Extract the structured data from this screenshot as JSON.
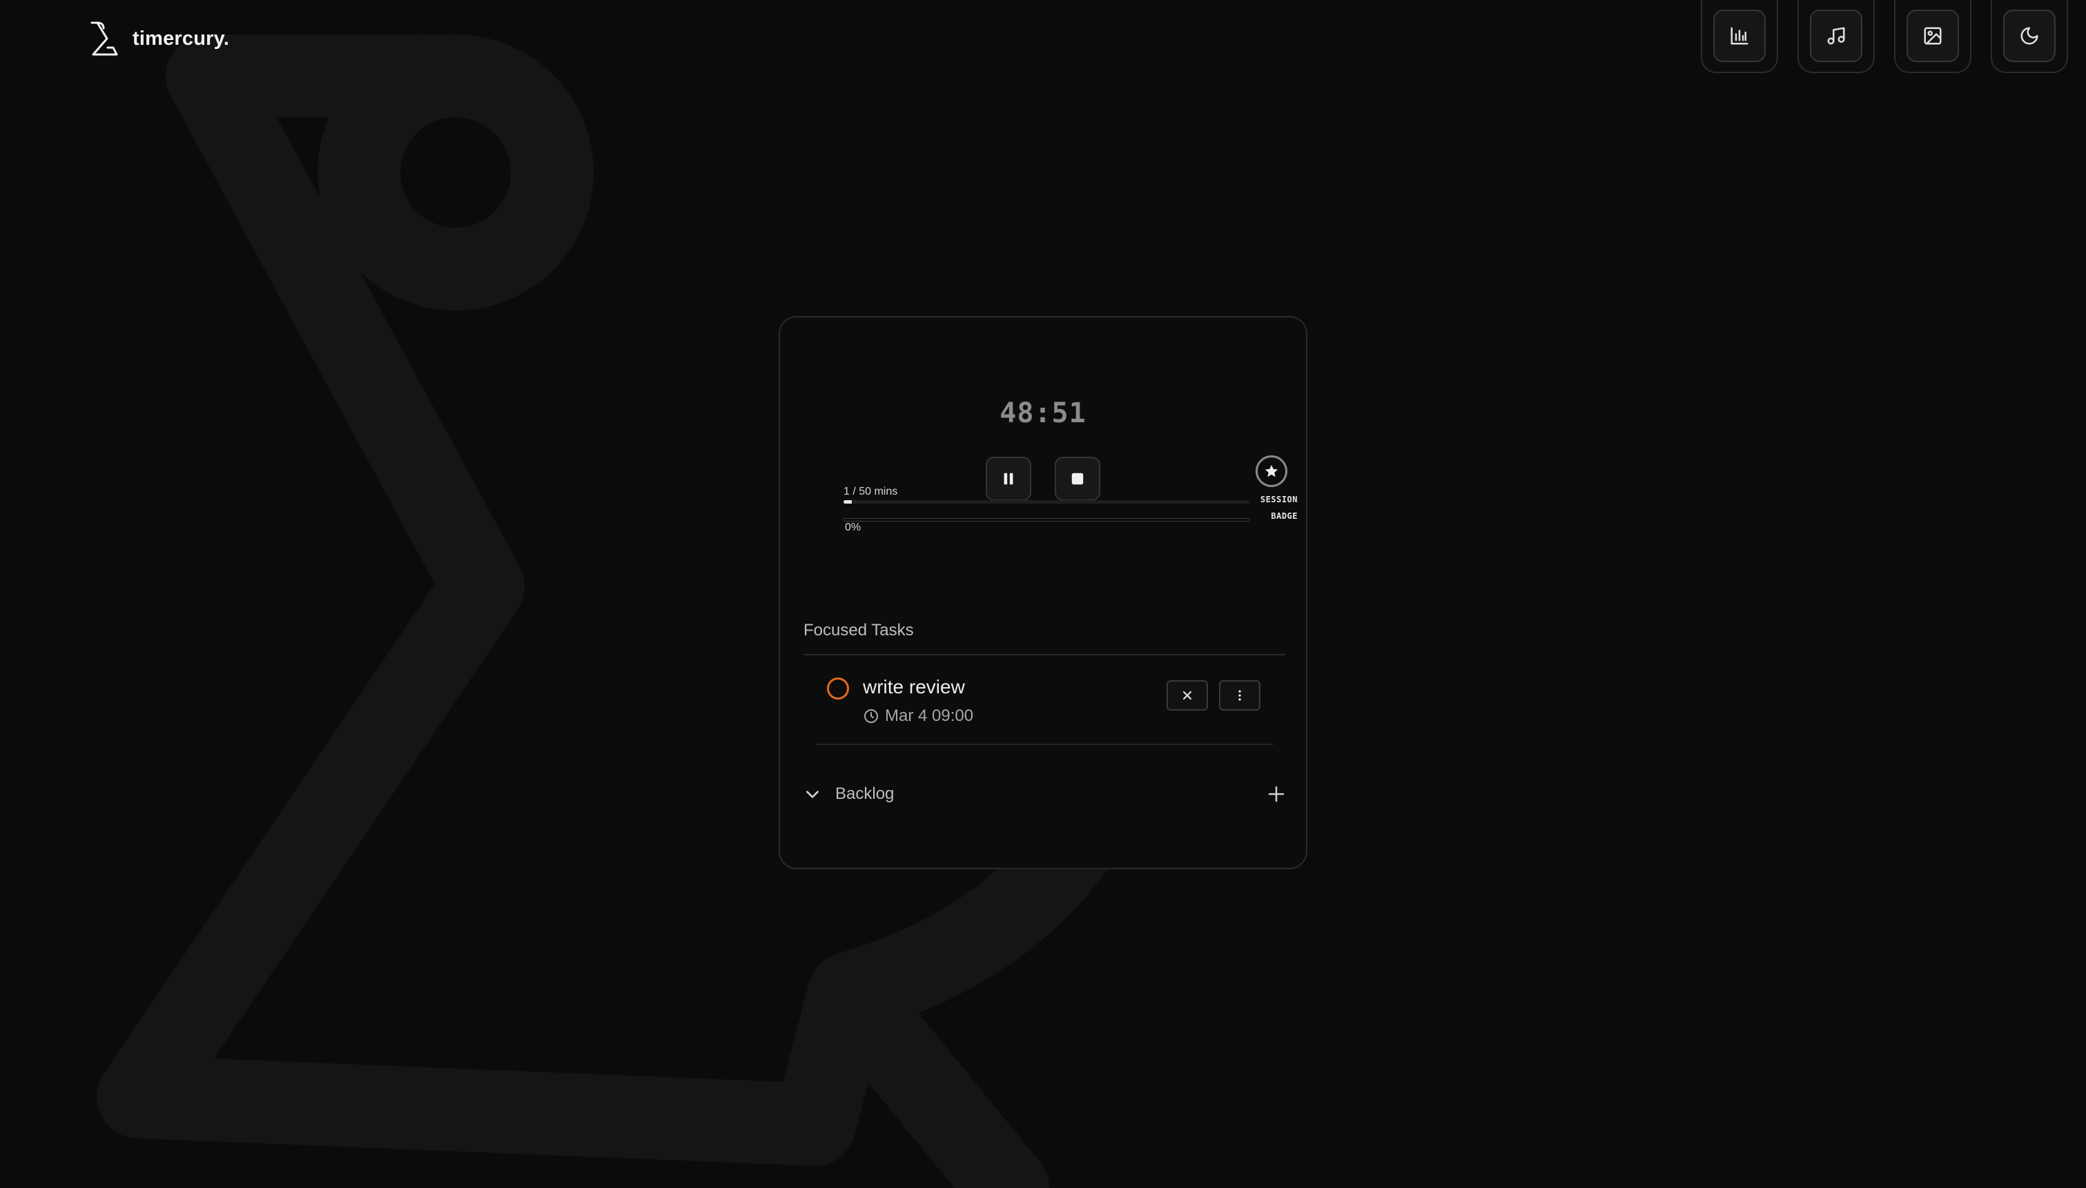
{
  "brand": {
    "name": "timercury.",
    "logo_icon": "sigma-hourglass-icon"
  },
  "top_nav": [
    {
      "name": "stats",
      "icon": "bar-chart-icon"
    },
    {
      "name": "music",
      "icon": "music-note-icon"
    },
    {
      "name": "background",
      "icon": "image-icon"
    },
    {
      "name": "theme",
      "icon": "moon-icon"
    }
  ],
  "timer": {
    "display": "48:51",
    "controls": {
      "pause_icon": "pause-icon",
      "stop_icon": "stop-icon"
    },
    "progress_label": "1 / 50 mins",
    "progress_fraction": 0.02,
    "secondary_progress_text": "0%",
    "secondary_progress_fraction": 0
  },
  "badge": {
    "icon": "star-icon",
    "line1": "SESSION",
    "line2": "BADGE"
  },
  "focused_tasks": {
    "title": "Focused Tasks",
    "items": [
      {
        "title": "write review",
        "date": "Mar 4 09:00",
        "status_color": "#e26a1d"
      }
    ]
  },
  "backlog": {
    "label": "Backlog"
  },
  "colors": {
    "background": "#0b0b0b",
    "accent": "#e26a1d",
    "card_border": "#2a2a2a"
  }
}
